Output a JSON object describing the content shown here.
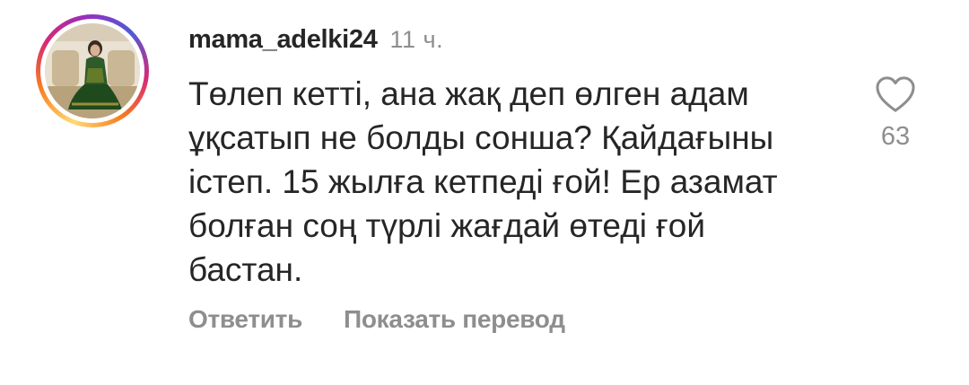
{
  "comment": {
    "username": "mama_adelki24",
    "time": "11 ч.",
    "text": "Төлеп кетті, ана жақ деп өлген адам ұқсатып не болды сонша? Қайдағыны істеп. 15 жылға кетпеді ғой! Ер азамат болған соң түрлі жағдай өтеді ғой бастан.",
    "like_count": "63",
    "actions": {
      "reply_label": "Ответить",
      "translate_label": "Показать перевод"
    }
  },
  "icons": {
    "like": "heart-icon"
  }
}
